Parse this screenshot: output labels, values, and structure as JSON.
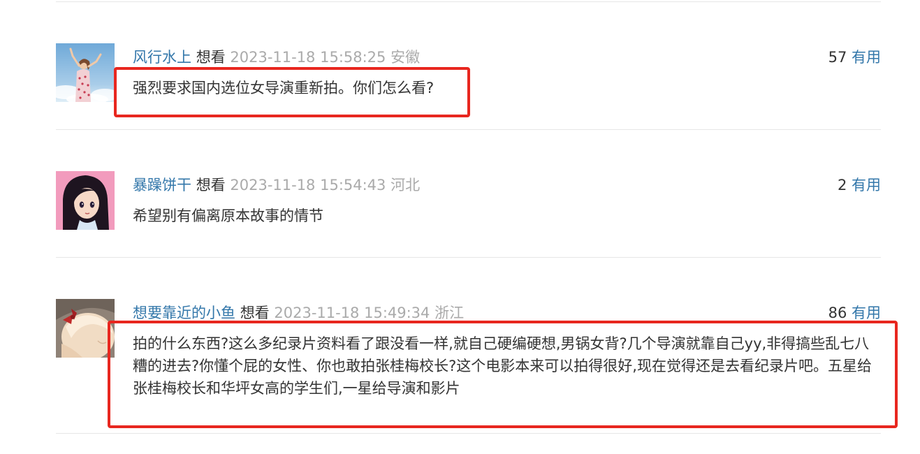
{
  "comments": [
    {
      "username": "风行水上",
      "status": "想看",
      "time": "2023-11-18 15:58:25",
      "location": "安徽",
      "vote_count": "57",
      "vote_label": "有用",
      "content": "强烈要求国内选位女导演重新拍。你们怎么看?",
      "highlighted": true
    },
    {
      "username": "暴躁饼干",
      "status": "想看",
      "time": "2023-11-18 15:54:43",
      "location": "河北",
      "vote_count": "2",
      "vote_label": "有用",
      "content": "希望别有偏离原本故事的情节",
      "highlighted": false
    },
    {
      "username": "想要靠近的小鱼",
      "status": "想看",
      "time": "2023-11-18 15:49:34",
      "location": "浙江",
      "vote_count": "86",
      "vote_label": "有用",
      "content": "拍的什么东西?这么多纪录片资料看了跟没看一样,就自己硬编硬想,男锅女背?几个导演就靠自己yy,非得搞些乱七八糟的进去?你懂个屁的女性、你也敢拍张桂梅校长?这个电影本来可以拍得很好,现在觉得还是去看纪录片吧。五星给张桂梅校长和华坪女高的学生们,一星给导演和影片",
      "highlighted": true
    }
  ],
  "colors": {
    "link": "#3377aa",
    "meta_gray": "#aaaaaa",
    "highlight_border": "#e8271f",
    "divider": "#e6e6e6"
  }
}
